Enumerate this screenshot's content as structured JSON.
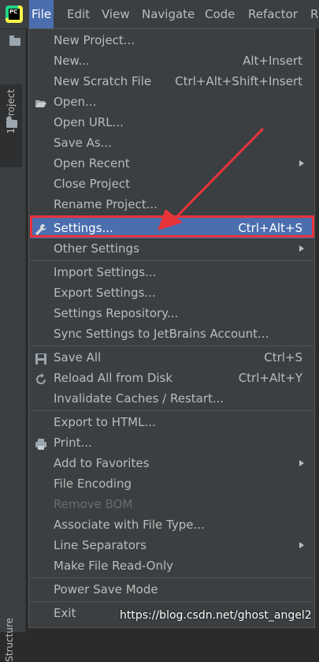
{
  "app": {
    "logo_text": "PC"
  },
  "menubar": {
    "items": [
      "File",
      "Edit",
      "View",
      "Navigate",
      "Code",
      "Refactor",
      "R"
    ]
  },
  "left_panel": {
    "project_tab": "1: Project",
    "structure_tab": "Structure"
  },
  "file_menu": {
    "items": [
      {
        "label": "New Project...",
        "shortcut": ""
      },
      {
        "label": "New...",
        "shortcut": "Alt+Insert"
      },
      {
        "label": "New Scratch File",
        "shortcut": "Ctrl+Alt+Shift+Insert"
      },
      {
        "label": "Open...",
        "shortcut": "",
        "icon": "folder-open-icon"
      },
      {
        "label": "Open URL...",
        "shortcut": ""
      },
      {
        "label": "Save As...",
        "shortcut": ""
      },
      {
        "label": "Open Recent",
        "shortcut": "",
        "submenu": true
      },
      {
        "label": "Close Project",
        "shortcut": ""
      },
      {
        "label": "Rename Project...",
        "shortcut": ""
      },
      {
        "label": "Settings...",
        "shortcut": "Ctrl+Alt+S",
        "icon": "wrench-icon",
        "selected": true
      },
      {
        "label": "Other Settings",
        "shortcut": "",
        "submenu": true
      },
      {
        "label": "Import Settings...",
        "shortcut": ""
      },
      {
        "label": "Export Settings...",
        "shortcut": ""
      },
      {
        "label": "Settings Repository...",
        "shortcut": ""
      },
      {
        "label": "Sync Settings to JetBrains Account...",
        "shortcut": ""
      },
      {
        "label": "Save All",
        "shortcut": "Ctrl+S",
        "icon": "save-icon"
      },
      {
        "label": "Reload All from Disk",
        "shortcut": "Ctrl+Alt+Y",
        "icon": "reload-icon"
      },
      {
        "label": "Invalidate Caches / Restart...",
        "shortcut": ""
      },
      {
        "label": "Export to HTML...",
        "shortcut": ""
      },
      {
        "label": "Print...",
        "shortcut": "",
        "icon": "printer-icon"
      },
      {
        "label": "Add to Favorites",
        "shortcut": "",
        "submenu": true
      },
      {
        "label": "File Encoding",
        "shortcut": ""
      },
      {
        "label": "Remove BOM",
        "shortcut": "",
        "disabled": true
      },
      {
        "label": "Associate with File Type...",
        "shortcut": ""
      },
      {
        "label": "Line Separators",
        "shortcut": "",
        "submenu": true
      },
      {
        "label": "Make File Read-Only",
        "shortcut": ""
      },
      {
        "label": "Power Save Mode",
        "shortcut": ""
      },
      {
        "label": "Exit",
        "shortcut": ""
      }
    ]
  },
  "watermark": "https://blog.csdn.net/ghost_angel2",
  "colors": {
    "selection": "#4b6eaf",
    "highlight_box": "#e8333a",
    "annotation_arrow": "#e8333a"
  }
}
